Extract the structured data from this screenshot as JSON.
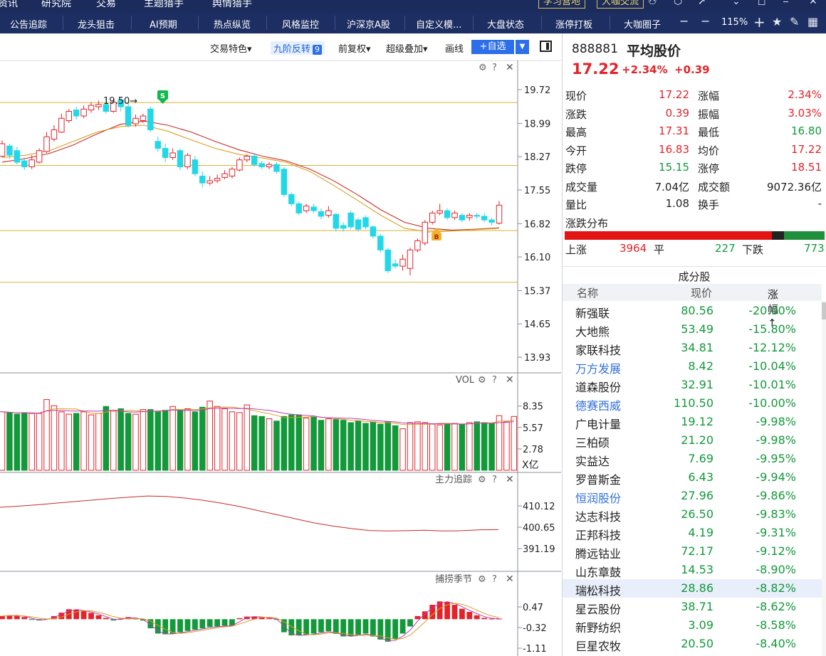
{
  "topstrip": {
    "items": [
      "资讯",
      "研究院",
      "交易",
      "主题猎手",
      "舆情猎手"
    ],
    "study_btn": "学习营地",
    "talk_btn": "大咖交流"
  },
  "nav": {
    "items": [
      "公告追踪",
      "龙头狙击",
      "AI预期",
      "热点纵览",
      "风格监控",
      "沪深京A股",
      "自定义模...",
      "大盘状态",
      "涨停打板",
      "大咖圈子"
    ],
    "zoom": "115%"
  },
  "toolbar": {
    "trade_feature": "交易特色▾",
    "nine_turn": "九阶反转",
    "nine_badge": "9",
    "pre_adjust": "前复权▾",
    "overlay": "超级叠加▾",
    "draw_line": "画线",
    "add_watch": "+自选",
    "add_watch_arrow": "▼"
  },
  "main_panel": {
    "y_labels": [
      "19.72",
      "18.99",
      "18.27",
      "17.55",
      "16.82",
      "16.10",
      "15.37",
      "14.65",
      "13.93"
    ],
    "annotation": "19.50→",
    "sell_marker": "S",
    "buy_marker": "B"
  },
  "vol_panel": {
    "title": "VOL",
    "y_labels": [
      "8.35",
      "5.57",
      "2.78"
    ],
    "unit": "X亿"
  },
  "main_force_panel": {
    "title": "主力追踪",
    "y_labels": [
      "410.12",
      "400.65",
      "391.19"
    ]
  },
  "season_panel": {
    "title": "捕捞季节",
    "y_labels": [
      "0.47",
      "-0.32",
      "-1.11"
    ]
  },
  "colors": {
    "up": "#e3232a",
    "down": "#12993a",
    "down_candle": "#22d8e8",
    "nav_bg": "#1c2e62",
    "accent": "#2c6fe8"
  },
  "chart_data": [
    {
      "type": "candlestick",
      "title": "",
      "y_range": [
        13.93,
        19.72
      ],
      "horizontal_levels": [
        19.44,
        18.08,
        16.67,
        15.55
      ],
      "moving_averages": [
        {
          "color": "#c92b2b",
          "values": [
            18.15,
            18.23,
            18.34,
            18.52,
            18.76,
            18.97,
            19.04,
            18.95,
            18.8,
            18.6,
            18.42,
            18.28,
            18.18,
            18.0,
            17.75,
            17.45,
            17.12,
            16.85,
            16.72,
            16.68,
            16.7,
            16.73
          ]
        },
        {
          "color": "#d9a020",
          "values": [
            18.25,
            18.3,
            18.4,
            18.6,
            18.8,
            18.92,
            18.95,
            18.82,
            18.63,
            18.45,
            18.32,
            18.24,
            18.15,
            17.95,
            17.65,
            17.33,
            17.0,
            16.72,
            16.64,
            16.66,
            16.69,
            16.72
          ]
        }
      ],
      "candles": [
        {
          "o": 18.28,
          "c": 18.55,
          "h": 18.62,
          "l": 18.25
        },
        {
          "o": 18.5,
          "c": 18.3,
          "h": 18.55,
          "l": 18.22
        },
        {
          "o": 18.4,
          "c": 18.15,
          "h": 18.48,
          "l": 18.1
        },
        {
          "o": 18.18,
          "c": 18.05,
          "h": 18.25,
          "l": 17.98
        },
        {
          "o": 18.05,
          "c": 18.2,
          "h": 18.3,
          "l": 18.0
        },
        {
          "o": 18.15,
          "c": 18.4,
          "h": 18.45,
          "l": 18.12
        },
        {
          "o": 18.38,
          "c": 18.7,
          "h": 18.8,
          "l": 18.35
        },
        {
          "o": 18.65,
          "c": 18.85,
          "h": 18.95,
          "l": 18.6
        },
        {
          "o": 18.8,
          "c": 19.1,
          "h": 19.2,
          "l": 18.78
        },
        {
          "o": 19.05,
          "c": 19.25,
          "h": 19.3,
          "l": 19.0
        },
        {
          "o": 19.28,
          "c": 19.15,
          "h": 19.35,
          "l": 19.08
        },
        {
          "o": 19.15,
          "c": 19.3,
          "h": 19.38,
          "l": 19.1
        },
        {
          "o": 19.28,
          "c": 19.38,
          "h": 19.45,
          "l": 19.22
        },
        {
          "o": 19.35,
          "c": 19.4,
          "h": 19.48,
          "l": 19.28
        },
        {
          "o": 19.4,
          "c": 19.25,
          "h": 19.52,
          "l": 19.2
        },
        {
          "o": 19.25,
          "c": 19.45,
          "h": 19.5,
          "l": 19.22
        },
        {
          "o": 19.5,
          "c": 19.35,
          "h": 19.55,
          "l": 19.25
        },
        {
          "o": 19.35,
          "c": 18.95,
          "h": 19.42,
          "l": 18.9
        },
        {
          "o": 18.98,
          "c": 19.1,
          "h": 19.18,
          "l": 18.92
        },
        {
          "o": 19.05,
          "c": 19.15,
          "h": 19.2,
          "l": 19.0
        },
        {
          "o": 19.3,
          "c": 18.85,
          "h": 19.35,
          "l": 18.8
        },
        {
          "o": 18.6,
          "c": 18.45,
          "h": 18.7,
          "l": 18.38
        },
        {
          "o": 18.45,
          "c": 18.25,
          "h": 18.55,
          "l": 18.15
        },
        {
          "o": 18.25,
          "c": 18.35,
          "h": 18.45,
          "l": 18.2
        },
        {
          "o": 18.4,
          "c": 18.05,
          "h": 18.45,
          "l": 17.98
        },
        {
          "o": 18.05,
          "c": 18.3,
          "h": 18.35,
          "l": 18.0
        },
        {
          "o": 18.2,
          "c": 17.9,
          "h": 18.28,
          "l": 17.85
        },
        {
          "o": 17.85,
          "c": 17.7,
          "h": 17.95,
          "l": 17.6
        },
        {
          "o": 17.7,
          "c": 17.75,
          "h": 17.85,
          "l": 17.65
        },
        {
          "o": 17.75,
          "c": 17.8,
          "h": 17.88,
          "l": 17.7
        },
        {
          "o": 17.82,
          "c": 17.9,
          "h": 17.98,
          "l": 17.78
        },
        {
          "o": 17.85,
          "c": 18.0,
          "h": 18.05,
          "l": 17.8
        },
        {
          "o": 17.98,
          "c": 18.2,
          "h": 18.25,
          "l": 17.95
        },
        {
          "o": 18.2,
          "c": 18.28,
          "h": 18.32,
          "l": 18.15
        },
        {
          "o": 18.28,
          "c": 18.1,
          "h": 18.35,
          "l": 18.05
        },
        {
          "o": 18.12,
          "c": 18.05,
          "h": 18.18,
          "l": 18.0
        },
        {
          "o": 18.05,
          "c": 18.1,
          "h": 18.15,
          "l": 18.0
        },
        {
          "o": 18.1,
          "c": 17.95,
          "h": 18.15,
          "l": 17.9
        },
        {
          "o": 18.0,
          "c": 17.45,
          "h": 18.05,
          "l": 17.4
        },
        {
          "o": 17.45,
          "c": 17.25,
          "h": 17.5,
          "l": 17.2
        },
        {
          "o": 17.25,
          "c": 17.05,
          "h": 17.3,
          "l": 17.0
        },
        {
          "o": 17.1,
          "c": 17.2,
          "h": 17.25,
          "l": 17.05
        },
        {
          "o": 17.18,
          "c": 17.1,
          "h": 17.25,
          "l": 17.05
        },
        {
          "o": 17.08,
          "c": 16.98,
          "h": 17.15,
          "l": 16.92
        },
        {
          "o": 17.0,
          "c": 17.1,
          "h": 17.2,
          "l": 16.95
        },
        {
          "o": 17.02,
          "c": 16.72,
          "h": 17.05,
          "l": 16.65
        },
        {
          "o": 16.78,
          "c": 16.72,
          "h": 16.85,
          "l": 16.65
        },
        {
          "o": 17.05,
          "c": 16.75,
          "h": 17.1,
          "l": 16.7
        },
        {
          "o": 16.9,
          "c": 16.7,
          "h": 16.95,
          "l": 16.65
        },
        {
          "o": 16.95,
          "c": 16.75,
          "h": 17.0,
          "l": 16.7
        },
        {
          "o": 16.75,
          "c": 16.55,
          "h": 16.78,
          "l": 16.5
        },
        {
          "o": 16.55,
          "c": 16.25,
          "h": 16.6,
          "l": 16.2
        },
        {
          "o": 16.25,
          "c": 15.8,
          "h": 16.3,
          "l": 15.75
        },
        {
          "o": 15.95,
          "c": 15.9,
          "h": 16.05,
          "l": 15.85
        },
        {
          "o": 15.9,
          "c": 16.05,
          "h": 16.15,
          "l": 15.8
        },
        {
          "o": 15.85,
          "c": 16.25,
          "h": 16.3,
          "l": 15.7
        },
        {
          "o": 16.25,
          "c": 16.45,
          "h": 16.5,
          "l": 16.2
        },
        {
          "o": 16.4,
          "c": 16.85,
          "h": 16.9,
          "l": 16.35
        },
        {
          "o": 16.85,
          "c": 17.05,
          "h": 17.1,
          "l": 16.8
        },
        {
          "o": 17.05,
          "c": 17.1,
          "h": 17.25,
          "l": 17.0
        },
        {
          "o": 17.1,
          "c": 16.95,
          "h": 17.15,
          "l": 16.9
        },
        {
          "o": 16.95,
          "c": 17.05,
          "h": 17.1,
          "l": 16.9
        },
        {
          "o": 17.0,
          "c": 16.9,
          "h": 17.05,
          "l": 16.85
        },
        {
          "o": 16.95,
          "c": 17.0,
          "h": 17.05,
          "l": 16.88
        },
        {
          "o": 17.0,
          "c": 16.98,
          "h": 17.05,
          "l": 16.92
        },
        {
          "o": 16.98,
          "c": 16.9,
          "h": 17.05,
          "l": 16.85
        },
        {
          "o": 16.9,
          "c": 16.85,
          "h": 16.95,
          "l": 16.78
        },
        {
          "o": 16.83,
          "c": 17.22,
          "h": 17.31,
          "l": 16.8
        }
      ]
    },
    {
      "type": "bar",
      "title": "VOL",
      "y_range": [
        0,
        11.1
      ],
      "values": [
        7.6,
        7.5,
        7.3,
        7.5,
        7.4,
        7.4,
        9.2,
        8.4,
        7.6,
        7.3,
        7.4,
        7.6,
        7.2,
        7.4,
        8.3,
        7.8,
        8.0,
        7.4,
        7.3,
        7.9,
        7.9,
        7.7,
        7.8,
        8.3,
        7.8,
        8.0,
        7.6,
        8.2,
        9.0,
        8.3,
        8.0,
        7.6,
        7.5,
        8.5,
        7.1,
        7.0,
        6.7,
        6.4,
        7.0,
        7.2,
        7.2,
        6.8,
        6.9,
        6.5,
        6.7,
        6.6,
        6.5,
        6.2,
        6.4,
        6.1,
        6.3,
        6.0,
        6.3,
        5.8,
        5.4,
        6.2,
        6.3,
        6.2,
        6.0,
        5.9,
        6.1,
        6.1,
        6.0,
        6.2,
        6.3,
        6.2,
        6.1,
        7.1,
        6.3,
        7.0
      ]
    },
    {
      "type": "line",
      "title": "主力追踪",
      "y_range": [
        391.19,
        410.12
      ],
      "values": [
        409.5,
        410.0,
        410.6,
        411.3,
        412.0,
        412.7,
        413.4,
        414.0,
        414.5,
        414.3,
        413.6,
        412.6,
        411.3,
        409.8,
        408.0,
        406.2,
        404.4,
        402.6,
        401.2,
        400.1,
        399.2,
        399.0,
        399.1,
        399.3,
        399.0,
        399.1,
        399.5,
        399.6
      ]
    },
    {
      "type": "bar",
      "title": "捕捞季节",
      "y_range": [
        -1.11,
        0.47
      ],
      "values": [
        0.12,
        0.15,
        0.14,
        0.08,
        -0.02,
        -0.05,
        0.02,
        0.12,
        0.25,
        0.38,
        0.36,
        0.31,
        0.24,
        0.15,
        0.05,
        -0.05,
        0.02,
        0.08,
        0.02,
        -0.05,
        -0.35,
        -0.55,
        -0.58,
        -0.55,
        -0.5,
        -0.45,
        -0.4,
        -0.35,
        -0.3,
        -0.28,
        -0.25,
        -0.24,
        0.04,
        0.1,
        0.1,
        0.07,
        0.03,
        -0.02,
        -0.5,
        -0.62,
        -0.62,
        -0.6,
        -0.55,
        -0.5,
        -0.46,
        -0.56,
        -0.66,
        -0.65,
        -0.6,
        -0.55,
        -0.66,
        -0.78,
        -0.86,
        -0.76,
        -0.55,
        -0.28,
        0.12,
        0.3,
        0.55,
        0.68,
        0.66,
        0.55,
        0.4,
        0.28,
        0.15,
        0.05,
        0.02,
        0.02
      ]
    }
  ],
  "quote": {
    "code": "888881",
    "name": "平均股价",
    "price": "17.22",
    "change_pct": "+2.34%",
    "change": "+0.39",
    "rows": [
      [
        "现价",
        "17.22",
        "涨幅",
        "2.34%"
      ],
      [
        "涨跌",
        "0.39",
        "振幅",
        "3.03%"
      ],
      [
        "最高",
        "17.31",
        "最低",
        "16.80"
      ],
      [
        "今开",
        "16.83",
        "均价",
        "17.22"
      ],
      [
        "跌停",
        "15.15",
        "涨停",
        "18.51"
      ],
      [
        "成交量",
        "7.04亿",
        "成交额",
        "9072.36亿"
      ],
      [
        "量比",
        "1.08",
        "换手",
        "-"
      ]
    ]
  },
  "distribution": {
    "label": "涨跌分布",
    "up_label": "上涨",
    "up_count": "3964",
    "flat_label": "平",
    "flat_count": "227",
    "down_label": "下跌",
    "down_count": "773",
    "up_value": 3964,
    "flat_value": 227,
    "down_value": 773
  },
  "constituents": {
    "title": "成分股",
    "headers": [
      "名称",
      "现价",
      "涨幅↑"
    ],
    "rows": [
      {
        "name": "新强联",
        "price": "80.56",
        "pct": "-20.00%",
        "blue": false
      },
      {
        "name": "大地熊",
        "price": "53.49",
        "pct": "-15.80%",
        "blue": false
      },
      {
        "name": "家联科技",
        "price": "34.81",
        "pct": "-12.12%",
        "blue": false
      },
      {
        "name": "万方发展",
        "price": "8.42",
        "pct": "-10.04%",
        "blue": true
      },
      {
        "name": "道森股份",
        "price": "32.91",
        "pct": "-10.01%",
        "blue": false
      },
      {
        "name": "德赛西威",
        "price": "110.50",
        "pct": "-10.00%",
        "blue": true
      },
      {
        "name": "广电计量",
        "price": "19.12",
        "pct": "-9.98%",
        "blue": false
      },
      {
        "name": "三柏硕",
        "price": "21.20",
        "pct": "-9.98%",
        "blue": false
      },
      {
        "name": "实益达",
        "price": "7.69",
        "pct": "-9.95%",
        "blue": false
      },
      {
        "name": "罗普斯金",
        "price": "6.43",
        "pct": "-9.94%",
        "blue": false
      },
      {
        "name": "恒润股份",
        "price": "27.96",
        "pct": "-9.86%",
        "blue": true
      },
      {
        "name": "达志科技",
        "price": "26.50",
        "pct": "-9.83%",
        "blue": false
      },
      {
        "name": "正邦科技",
        "price": "4.19",
        "pct": "-9.31%",
        "blue": false
      },
      {
        "name": "腾远钴业",
        "price": "72.17",
        "pct": "-9.12%",
        "blue": false
      },
      {
        "name": "山东章鼓",
        "price": "14.53",
        "pct": "-8.90%",
        "blue": false
      },
      {
        "name": "瑞松科技",
        "price": "28.86",
        "pct": "-8.82%",
        "blue": false
      },
      {
        "name": "星云股份",
        "price": "38.71",
        "pct": "-8.62%",
        "blue": false
      },
      {
        "name": "新野纺织",
        "price": "3.09",
        "pct": "-8.58%",
        "blue": false
      },
      {
        "name": "巨星农牧",
        "price": "20.50",
        "pct": "-8.40%",
        "blue": false
      }
    ],
    "highlight_index": 15
  }
}
